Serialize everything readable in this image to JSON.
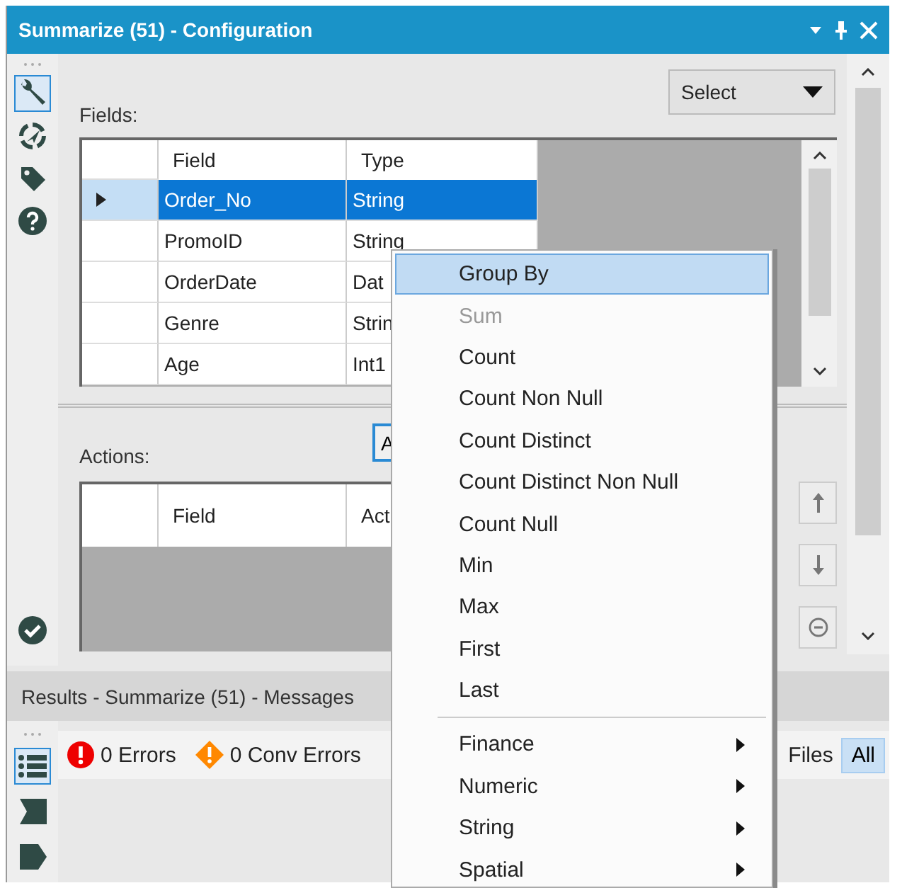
{
  "window": {
    "title": "Summarize (51) - Configuration"
  },
  "tool_strip": [
    {
      "kind": "wrench",
      "selected": true
    },
    {
      "kind": "target",
      "selected": false
    },
    {
      "kind": "tag",
      "selected": false
    },
    {
      "kind": "help",
      "selected": false
    }
  ],
  "fields_label": "Fields:",
  "select_button": "Select",
  "fields_table": {
    "columns": [
      "Field",
      "Type"
    ],
    "rows": [
      {
        "field": "Order_No",
        "type": "String",
        "selected": true
      },
      {
        "field": "PromoID",
        "type": "String",
        "selected": false
      },
      {
        "field": "OrderDate",
        "type": "Dat",
        "selected": false
      },
      {
        "field": "Genre",
        "type": "Strin",
        "selected": false
      },
      {
        "field": "Age",
        "type": "Int1",
        "selected": false
      }
    ]
  },
  "actions_label": "Actions:",
  "add_button": "A",
  "actions_table": {
    "columns": [
      "Field",
      "Act"
    ]
  },
  "results": {
    "title": "Results - Summarize (51) - Messages",
    "side_tools": [
      {
        "kind": "list",
        "selected": true
      },
      {
        "kind": "flag",
        "selected": false
      },
      {
        "kind": "tag",
        "selected": false
      }
    ],
    "filters": [
      {
        "kind": "error",
        "label": "0 Errors"
      },
      {
        "kind": "conversion",
        "label": "0 Conv Errors"
      }
    ],
    "files_label": "Files",
    "all_button": {
      "label": "All",
      "selected": true
    }
  },
  "context_menu": {
    "items": [
      {
        "kind": "action",
        "label": "Group By",
        "selected": true,
        "disabled": false
      },
      {
        "kind": "action",
        "label": "Sum",
        "selected": false,
        "disabled": true
      },
      {
        "kind": "action",
        "label": "Count",
        "selected": false,
        "disabled": false
      },
      {
        "kind": "action",
        "label": "Count Non Null",
        "selected": false,
        "disabled": false
      },
      {
        "kind": "action",
        "label": "Count Distinct",
        "selected": false,
        "disabled": false
      },
      {
        "kind": "action",
        "label": "Count Distinct Non Null",
        "selected": false,
        "disabled": false
      },
      {
        "kind": "action",
        "label": "Count Null",
        "selected": false,
        "disabled": false
      },
      {
        "kind": "action",
        "label": "Min",
        "selected": false,
        "disabled": false
      },
      {
        "kind": "action",
        "label": "Max",
        "selected": false,
        "disabled": false
      },
      {
        "kind": "action",
        "label": "First",
        "selected": false,
        "disabled": false
      },
      {
        "kind": "action",
        "label": "Last",
        "selected": false,
        "disabled": false
      },
      {
        "kind": "separator"
      },
      {
        "kind": "submenu",
        "label": "Finance",
        "selected": false,
        "disabled": false
      },
      {
        "kind": "submenu",
        "label": "Numeric",
        "selected": false,
        "disabled": false
      },
      {
        "kind": "submenu",
        "label": "String",
        "selected": false,
        "disabled": false
      },
      {
        "kind": "submenu",
        "label": "Spatial",
        "selected": false,
        "disabled": false
      }
    ]
  }
}
